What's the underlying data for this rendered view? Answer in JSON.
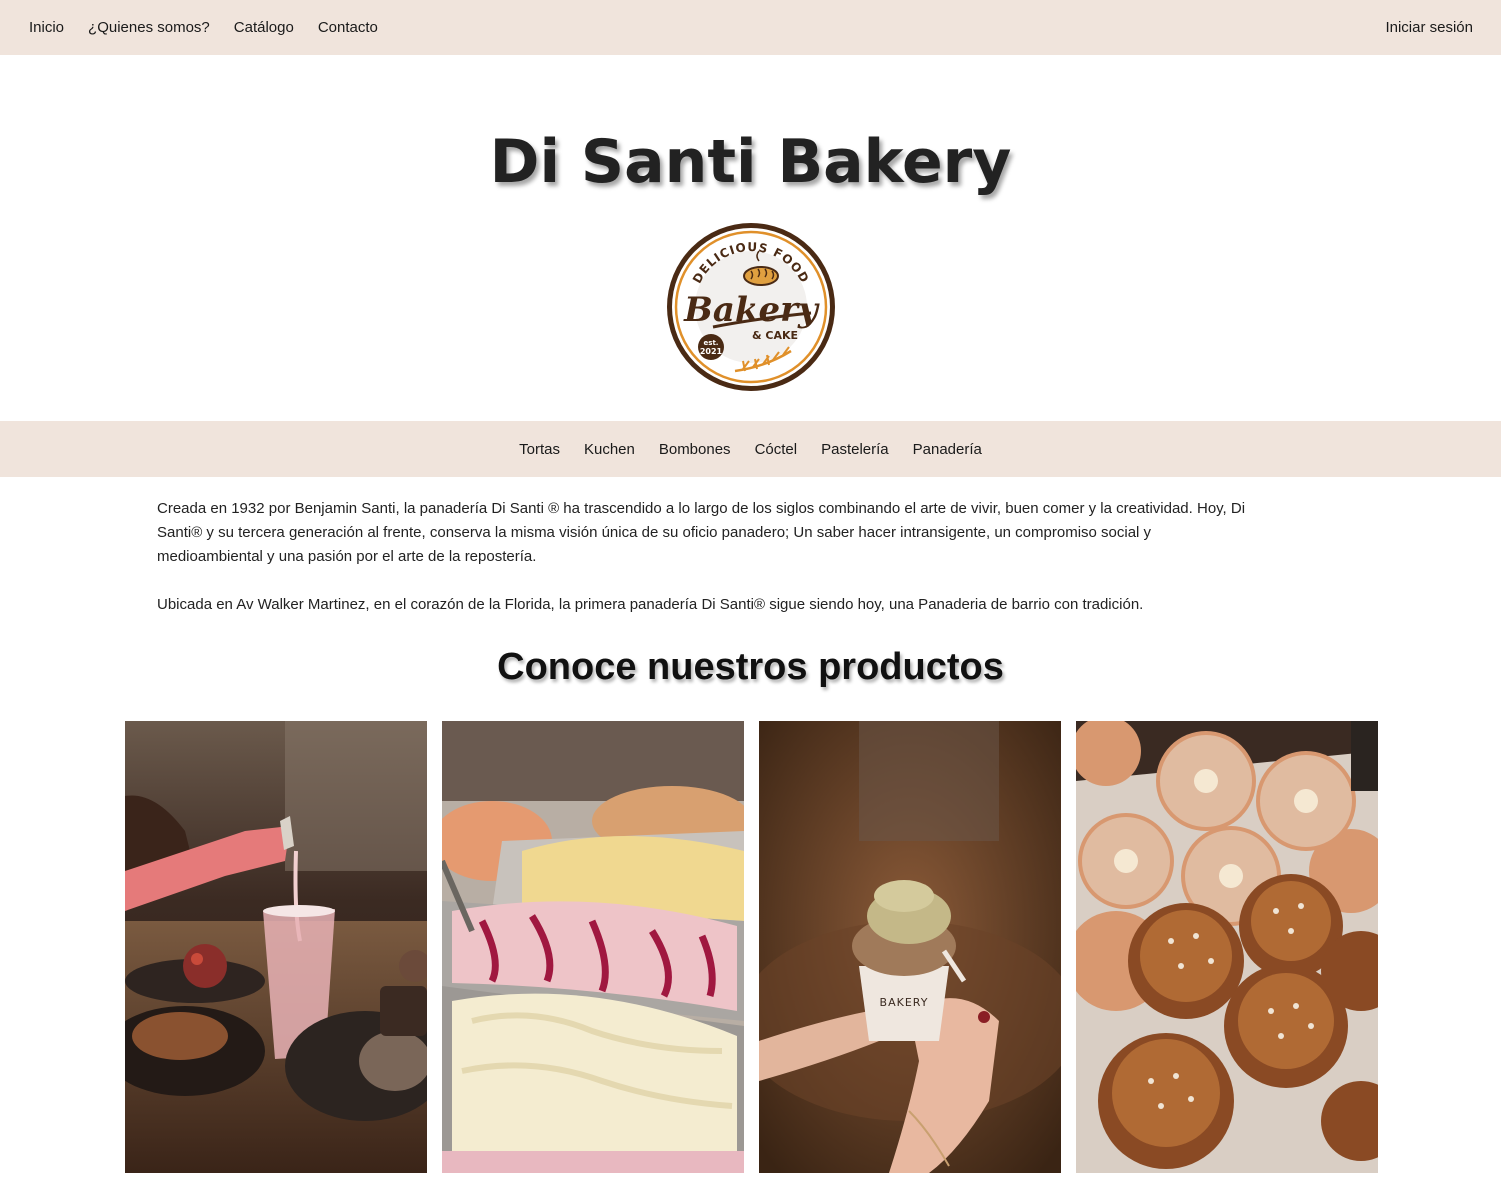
{
  "topnav": {
    "links": [
      "Inicio",
      "¿Quienes somos?",
      "Catálogo",
      "Contacto"
    ],
    "login": "Iniciar sesión"
  },
  "hero": {
    "title": "Di Santi Bakery"
  },
  "logo": {
    "top_text": "DELICIOUS FOOD",
    "main_text": "Bakery",
    "sub_text": "& CAKE",
    "badge_line1": "est.",
    "badge_line2": "2021"
  },
  "catnav": {
    "links": [
      "Tortas",
      "Kuchen",
      "Bombones",
      "Cóctel",
      "Pastelería",
      "Panadería"
    ]
  },
  "intro": {
    "paragraph1": "Creada en 1932 por Benjamin Santi, la panadería Di Santi ® ha trascendido a lo largo de los siglos combinando el arte de vivir, buen comer y la creatividad. Hoy, Di Santi® y su tercera generación al frente, conserva la misma visión única de su oficio panadero; Un saber hacer intransigente, un compromiso social y medioambiental y una pasión por el arte de la repostería.",
    "paragraph2": "Ubicada en Av Walker Martinez, en el corazón de la Florida, la primera panadería Di Santi® sigue siendo hoy, una Panaderia de barrio con tradición."
  },
  "products": {
    "title": "Conoce nuestros productos",
    "cup_text": "BAKERY",
    "images": [
      {
        "icon": "drink-pour-photo"
      },
      {
        "icon": "ice-cream-trays-photo"
      },
      {
        "icon": "ice-cream-cup-photo"
      },
      {
        "icon": "donuts-photo"
      }
    ]
  },
  "colors": {
    "nav_bg": "#f0e4dc",
    "logo_brown": "#4a2a14",
    "logo_orange": "#e0902a"
  }
}
